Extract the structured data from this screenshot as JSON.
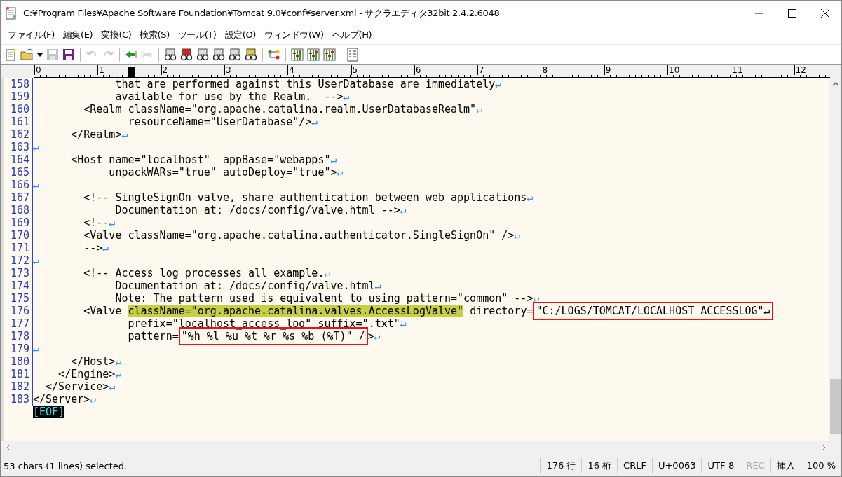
{
  "window": {
    "title": "C:¥Program Files¥Apache Software Foundation¥Tomcat 9.0¥conf¥server.xml - サクラエディタ32bit 2.4.2.6048"
  },
  "menu": [
    "ファイル(F)",
    "編集(E)",
    "変換(C)",
    "検索(S)",
    "ツール(T)",
    "設定(O)",
    "ウィンドウ(W)",
    "ヘルプ(H)"
  ],
  "toolbar": [
    {
      "kind": "new",
      "disabled": false
    },
    {
      "kind": "open",
      "disabled": false
    },
    {
      "kind": "dropdown",
      "disabled": false
    },
    {
      "kind": "save",
      "disabled": true
    },
    {
      "kind": "save-all",
      "disabled": false
    },
    {
      "kind": "separator"
    },
    {
      "kind": "undo",
      "disabled": true
    },
    {
      "kind": "redo",
      "disabled": true
    },
    {
      "kind": "separator"
    },
    {
      "kind": "back",
      "disabled": false
    },
    {
      "kind": "forward",
      "disabled": true
    },
    {
      "kind": "separator"
    },
    {
      "kind": "find",
      "disabled": false
    },
    {
      "kind": "find-down",
      "disabled": false
    },
    {
      "kind": "find-up",
      "disabled": false
    },
    {
      "kind": "replace",
      "disabled": false
    },
    {
      "kind": "clear",
      "disabled": false
    },
    {
      "kind": "grep",
      "disabled": false
    },
    {
      "kind": "separator"
    },
    {
      "kind": "outline",
      "disabled": false
    },
    {
      "kind": "separator"
    },
    {
      "kind": "config",
      "disabled": false
    },
    {
      "kind": "config",
      "disabled": false
    },
    {
      "kind": "config",
      "disabled": false
    },
    {
      "kind": "separator"
    },
    {
      "kind": "list",
      "disabled": false
    }
  ],
  "ruler": [
    "0",
    "1",
    "2",
    "3",
    "4",
    "5",
    "6",
    "7",
    "8",
    "9",
    "10",
    "11",
    "12"
  ],
  "editor": {
    "lines": [
      {
        "number": "158",
        "segments": [
          {
            "kind": "text",
            "text": "             that are performed against this UserDatabase are immediately"
          },
          {
            "kind": "eol",
            "text": "↵"
          }
        ]
      },
      {
        "number": "159",
        "segments": [
          {
            "kind": "text",
            "text": "             available for use by the Realm.  -->"
          },
          {
            "kind": "eol",
            "text": "↵"
          }
        ]
      },
      {
        "number": "160",
        "segments": [
          {
            "kind": "text",
            "text": "        <Realm className=\"org.apache.catalina.realm.UserDatabaseRealm\""
          },
          {
            "kind": "eol",
            "text": "↵"
          }
        ]
      },
      {
        "number": "161",
        "segments": [
          {
            "kind": "text",
            "text": "               resourceName=\"UserDatabase\"/>"
          },
          {
            "kind": "eol",
            "text": "↵"
          }
        ]
      },
      {
        "number": "162",
        "segments": [
          {
            "kind": "text",
            "text": "      </Realm>"
          },
          {
            "kind": "eol",
            "text": "↵"
          }
        ]
      },
      {
        "number": "163",
        "segments": [
          {
            "kind": "eol",
            "text": "↵"
          }
        ]
      },
      {
        "number": "164",
        "segments": [
          {
            "kind": "text",
            "text": "      <Host name=\"localhost\"  appBase=\"webapps\""
          },
          {
            "kind": "eol",
            "text": "↵"
          }
        ]
      },
      {
        "number": "165",
        "segments": [
          {
            "kind": "text",
            "text": "            unpackWARs=\"true\" autoDeploy=\"true\">"
          },
          {
            "kind": "eol",
            "text": "↵"
          }
        ]
      },
      {
        "number": "166",
        "segments": [
          {
            "kind": "eol",
            "text": "↵"
          }
        ]
      },
      {
        "number": "167",
        "segments": [
          {
            "kind": "text",
            "text": "        <!-- SingleSignOn valve, share authentication between web applications"
          },
          {
            "kind": "eol",
            "text": "↵"
          }
        ]
      },
      {
        "number": "168",
        "segments": [
          {
            "kind": "text",
            "text": "             Documentation at: /docs/config/valve.html -->"
          },
          {
            "kind": "eol",
            "text": "↵"
          }
        ]
      },
      {
        "number": "169",
        "segments": [
          {
            "kind": "text",
            "text": "        <!--"
          },
          {
            "kind": "eol",
            "text": "↵"
          }
        ]
      },
      {
        "number": "170",
        "segments": [
          {
            "kind": "text",
            "text": "        <Valve className=\"org.apache.catalina.authenticator.SingleSignOn\" />"
          },
          {
            "kind": "eol",
            "text": "↵"
          }
        ]
      },
      {
        "number": "171",
        "segments": [
          {
            "kind": "text",
            "text": "        -->"
          },
          {
            "kind": "eol",
            "text": "↵"
          }
        ]
      },
      {
        "number": "172",
        "segments": [
          {
            "kind": "eol",
            "text": "↵"
          }
        ]
      },
      {
        "number": "173",
        "segments": [
          {
            "kind": "text",
            "text": "        <!-- Access log processes all example."
          },
          {
            "kind": "eol",
            "text": "↵"
          }
        ]
      },
      {
        "number": "174",
        "segments": [
          {
            "kind": "text",
            "text": "             Documentation at: /docs/config/valve.html"
          },
          {
            "kind": "eol",
            "text": "↵"
          }
        ]
      },
      {
        "number": "175",
        "segments": [
          {
            "kind": "text",
            "text": "             Note: The pattern used is equivalent to using pattern=\"common\" -->"
          },
          {
            "kind": "eol",
            "text": "↵"
          }
        ]
      },
      {
        "number": "176",
        "segments": [
          {
            "kind": "text",
            "text": "        <Valve "
          },
          {
            "kind": "selected",
            "text": "className=\"org.apache.catalina.valves.AccessLogValve\""
          },
          {
            "kind": "text",
            "text": " directory="
          },
          {
            "kind": "boxed",
            "text": "\"C:/LOGS/TOMCAT/LOCALHOST_ACCESSLOG\"↵"
          }
        ]
      },
      {
        "number": "177",
        "segments": [
          {
            "kind": "text",
            "text": "               prefix=\"localhost_access_log\" suffix=\".txt\""
          },
          {
            "kind": "eol",
            "text": "↵"
          }
        ]
      },
      {
        "number": "178",
        "segments": [
          {
            "kind": "text",
            "text": "               pattern="
          },
          {
            "kind": "boxed",
            "text": "\"%h %l %u %t %r %s %b (%T)\" /"
          },
          {
            "kind": "text",
            "text": ">"
          },
          {
            "kind": "eol",
            "text": "↵"
          }
        ]
      },
      {
        "number": "179",
        "segments": [
          {
            "kind": "eol",
            "text": "↵"
          }
        ]
      },
      {
        "number": "180",
        "segments": [
          {
            "kind": "text",
            "text": "      </Host>"
          },
          {
            "kind": "eol",
            "text": "↵"
          }
        ]
      },
      {
        "number": "181",
        "segments": [
          {
            "kind": "text",
            "text": "    </Engine>"
          },
          {
            "kind": "eol",
            "text": "↵"
          }
        ]
      },
      {
        "number": "182",
        "segments": [
          {
            "kind": "text",
            "text": "  </Service>"
          },
          {
            "kind": "eol",
            "text": "↵"
          }
        ]
      },
      {
        "number": "183",
        "segments": [
          {
            "kind": "text",
            "text": "</Server>"
          },
          {
            "kind": "eol",
            "text": "↵"
          }
        ]
      }
    ],
    "eof": "[EOF]"
  },
  "status_bar": {
    "message": "53 chars (1 lines) selected.",
    "items": [
      {
        "text": "176 行",
        "disabled": false
      },
      {
        "text": "16 桁",
        "disabled": false
      },
      {
        "text": "CRLF",
        "disabled": false
      },
      {
        "text": "U+0063",
        "disabled": false
      },
      {
        "text": "UTF-8",
        "disabled": false
      },
      {
        "text": "REC",
        "disabled": true
      },
      {
        "text": "挿入",
        "disabled": false
      },
      {
        "text": "100 %",
        "disabled": false
      }
    ]
  }
}
